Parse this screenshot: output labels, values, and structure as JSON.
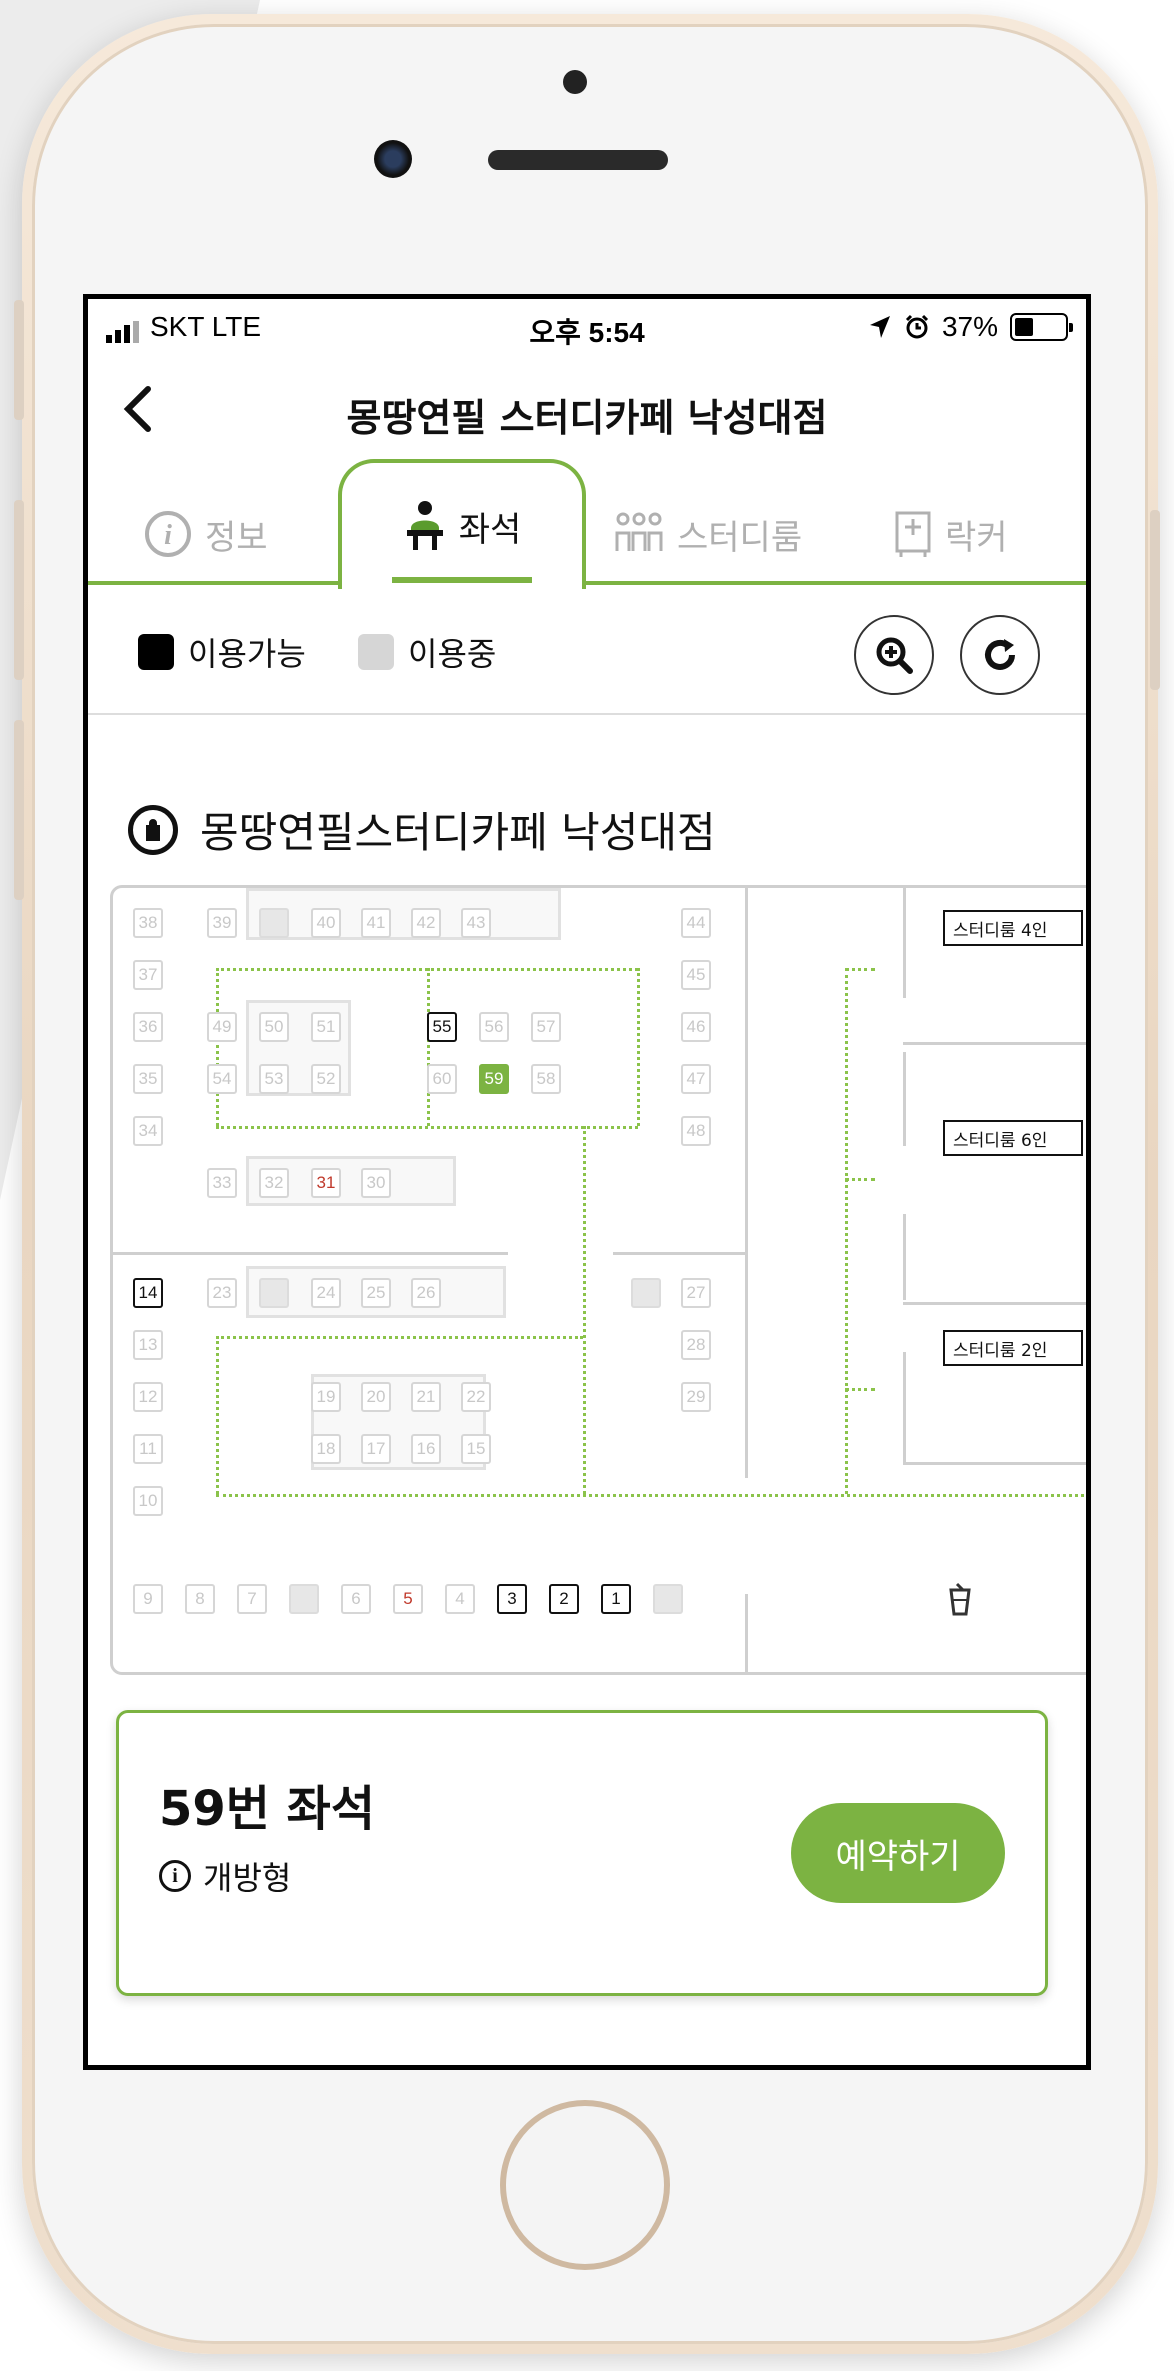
{
  "status_bar": {
    "carrier": "SKT   LTE",
    "time": "오후 5:54",
    "battery": "37%",
    "battery_level": 0.37
  },
  "header": {
    "title": "몽땅연필 스터디카페 낙성대점"
  },
  "tabs": [
    {
      "label": "정보",
      "icon": "info-icon",
      "active": false
    },
    {
      "label": "좌석",
      "icon": "seat-person-icon",
      "active": true
    },
    {
      "label": "스터디룸",
      "icon": "group-icon",
      "active": false
    },
    {
      "label": "락커",
      "icon": "locker-icon",
      "active": false
    }
  ],
  "legend": {
    "available": "이용가능",
    "in_use": "이용중",
    "available_color": "#000000",
    "in_use_color": "#d6d6d6"
  },
  "map_title": "몽땅연필스터디카페 낙성대점",
  "seats": {
    "available": [
      "1",
      "2",
      "3",
      "14",
      "55",
      "59"
    ],
    "selected": "59",
    "highlighted_red": [
      "5",
      "31"
    ],
    "accent_color": "#7cb342"
  },
  "rooms": {
    "room4": "스터디룸 4인",
    "room6": "스터디룸 6인",
    "room2": "스터디룸 2인"
  },
  "detail_card": {
    "seat_title": "59번 좌석",
    "seat_type": "개방형",
    "reserve_label": "예약하기"
  }
}
